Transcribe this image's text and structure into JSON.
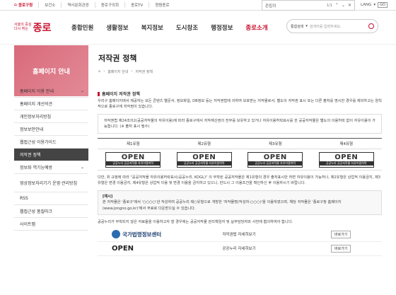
{
  "topbar": {
    "home": "종로구청",
    "links": [
      "보건소",
      "역사문화관광",
      "종로구의회",
      "종로TV",
      "청렴종로"
    ]
  },
  "find": {
    "query": "존립의",
    "count": "1/1"
  },
  "lang": {
    "label": "LANG",
    "go": "GO"
  },
  "logo": {
    "small_line1": "서울의 중심",
    "small_line2": "다시 뛰는",
    "big": "종로"
  },
  "gnb": [
    "종합민원",
    "생활정보",
    "복지정보",
    "도시창조",
    "행정정보",
    "종로소개"
  ],
  "search": {
    "select": "통합검색",
    "placeholder": "검색어를 입력하세요."
  },
  "hero": {
    "section": "홈페이지 안내",
    "title": "저작권 정책",
    "breadcrumb": [
      "홈페이지 안내",
      "저작권 정책"
    ]
  },
  "sidebar": [
    "홈페이지 이용 안내",
    "홈페이지 개선의견",
    "개인정보처리방침",
    "정보보안안내",
    "웹접근성 이용가이드",
    "저작권 정책",
    "정보화 역기능예방",
    "영상정보처리기기 운영·관리방침",
    "RSS",
    "웹접근성 품질마크",
    "사이트맵"
  ],
  "content": {
    "title": "홈페이지 저작권 정책",
    "intro": "우리구 홈페이지에서 제공하는 모든 콘텐츠 별문서, 정보화일, DB정보 등는 저작권법에 의하여 보호받는 저작물로서, 별도의 저작권 표시 또는 다른 출처를 명시한 경우를 제외하고는 원칙적으로 종로구에 저작권이 있습니다.",
    "box": "저작권법 제24조의2(공공저작물의 자유이용)에 따라 종로구에서 저작재산권의 전부를 보유하고 있거나 자유이용허락표시를 한 공공저작물은 별도의 이용허락 없이 자유이용이 가능합니다. (※ 출처 표시 필수)",
    "types": [
      "제1유형",
      "제2유형",
      "제3유형",
      "제4유형"
    ],
    "open": "OPEN",
    "open_sub": [
      "공공누리 공공저작물 자유이용허락",
      "공공누리 공공저작물 자유이용허락",
      "공공누리 공공저작물 자유이용허락",
      "공공누리 공공저작물 자유이용허락"
    ],
    "desc": "다만, 위 규정에 따라 \"공공저작물 자유이용허락표시(공공누리, KOGL)\" 의 부착된 공공저작물은 제1유형의 경우 출처표시만 하면 자유이용이 가능하나, 제2유형은 상업적 이용금지, 제3유형은 변경 이용금지, 제4유형은 상업적 이용 및 변경 이용을 금지하고 있으니, 반드시 그 이용조건을 확인하신 후 이용하시기 바랍니다.",
    "ex_title": "[예시]",
    "ex_text": "본 저작물은 '종로구'에서 '○○○○'년 작성하여 공공누리 제○유형으로 개방한 '저작물명(작성자:○○○)'을 이용하였으며, 해당 저작물은 '종로구청 홈페이지(www.jongno.go.kr)'에서 무료로 다운받으실 수 있습니다.",
    "footnote": "공공누리가 부착되지 않은 자료들을 이용하고자 할 경우에는 공공저작물 관리책임자 및 실무담당자와 사전에 협의하여야 합니다.",
    "bottom": [
      {
        "logo": "국가법령정보센터",
        "label": "저작권법 자세히보기",
        "btn": "바로가기"
      },
      {
        "logo": "OPEN",
        "label": "공공누리 자세히보기",
        "btn": "바로가기"
      }
    ]
  }
}
